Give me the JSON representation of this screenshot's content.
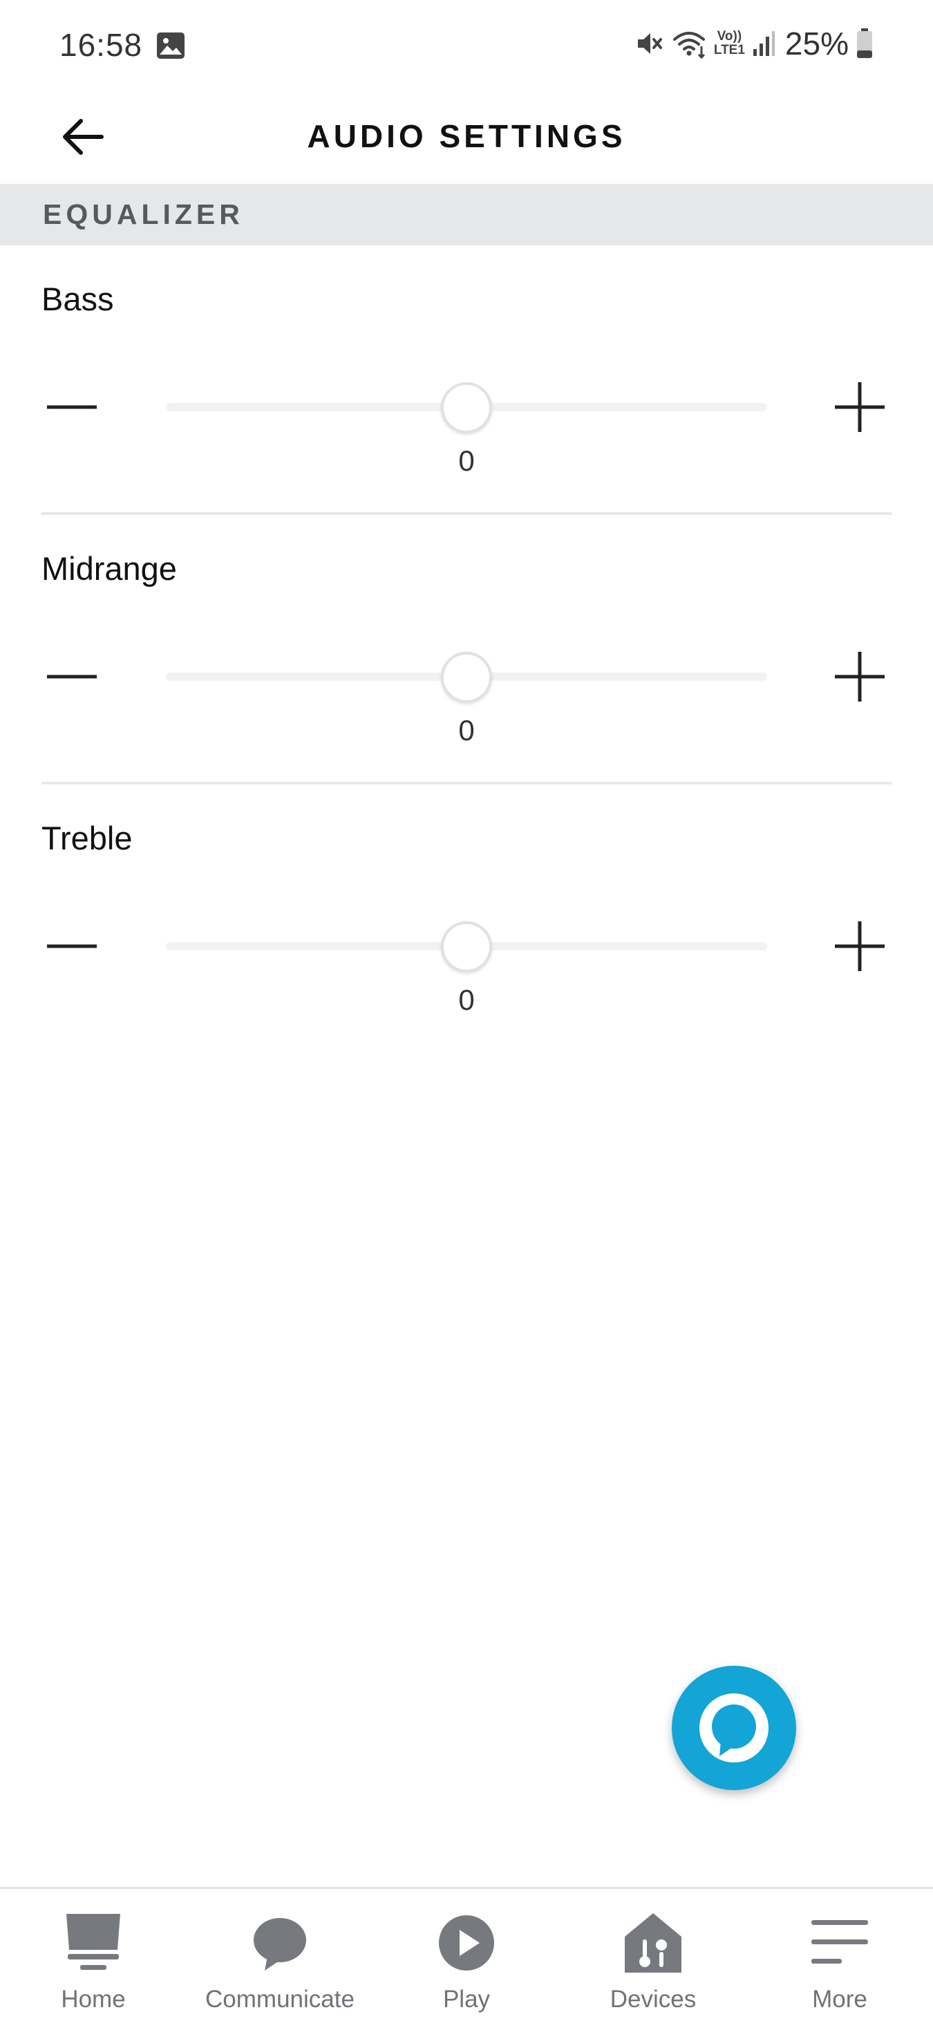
{
  "status_bar": {
    "time": "16:58",
    "battery_percent": "25%",
    "icons": [
      "gallery-icon",
      "mute-icon",
      "wifi-icon",
      "volte-icon",
      "signal-icon",
      "battery-icon"
    ],
    "volte_line1": "Vo))",
    "volte_line2": "LTE1"
  },
  "header": {
    "title": "AUDIO SETTINGS",
    "back_icon": "arrow-left-icon"
  },
  "equalizer": {
    "section_title": "EQUALIZER",
    "range": [
      -6,
      6
    ],
    "bands": [
      {
        "label": "Bass",
        "value": "0"
      },
      {
        "label": "Midrange",
        "value": "0"
      },
      {
        "label": "Treble",
        "value": "0"
      }
    ]
  },
  "fab": {
    "icon": "alexa-icon"
  },
  "bottom_nav": {
    "items": [
      {
        "label": "Home",
        "icon": "home-icon"
      },
      {
        "label": "Communicate",
        "icon": "chat-bubble-icon"
      },
      {
        "label": "Play",
        "icon": "play-icon"
      },
      {
        "label": "Devices",
        "icon": "devices-icon"
      },
      {
        "label": "More",
        "icon": "menu-icon"
      }
    ]
  },
  "colors": {
    "accent": "#12a5d6",
    "section_bg": "#e6e7e8",
    "nav_icon": "#76797d",
    "nav_label": "#6e7378"
  }
}
